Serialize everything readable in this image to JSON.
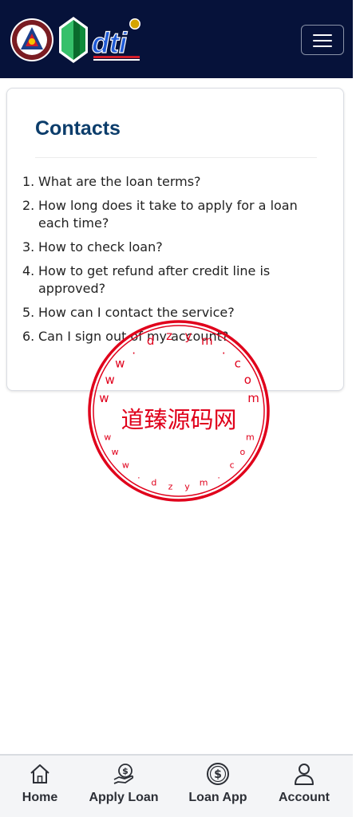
{
  "header": {
    "logo_seal_name": "ph-government-seal",
    "logo_gem_name": "dti-gem-logo",
    "logo_wordmark": "dti",
    "menu_icon": "hamburger-icon"
  },
  "page": {
    "title": "Contacts",
    "faq": [
      {
        "num": "1.",
        "text": "What are the loan terms?"
      },
      {
        "num": "2.",
        "text": "How long does it take to apply for a loan each time?"
      },
      {
        "num": "3.",
        "text": "How to check loan?"
      },
      {
        "num": "4.",
        "text": "How to get refund after credit line is approved?"
      },
      {
        "num": "5.",
        "text": "How can I contact the service?"
      },
      {
        "num": "6.",
        "text": "Can I sign out of my account?"
      }
    ]
  },
  "watermark": {
    "center_text": "道臻源码网",
    "ring_text": "www.dzym.com"
  },
  "bottom_nav": [
    {
      "label": "Home",
      "icon": "home-icon"
    },
    {
      "label": "Apply Loan",
      "icon": "money-hand-icon"
    },
    {
      "label": "Loan App",
      "icon": "dollar-coin-icon"
    },
    {
      "label": "Account",
      "icon": "user-icon"
    }
  ],
  "colors": {
    "navbar_bg": "#06123a",
    "title": "#0c3d6b",
    "stamp_red": "#e0001b",
    "nav_bg": "#f4f5f7"
  }
}
